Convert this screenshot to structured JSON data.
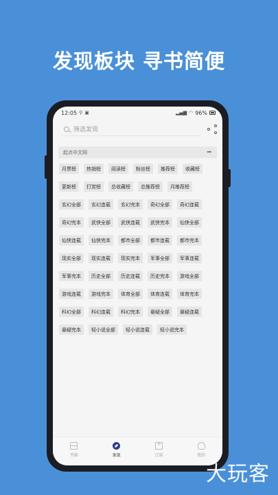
{
  "headline": "发现板块  寻书简便",
  "statusbar": {
    "time": "12:05",
    "battery": "96%"
  },
  "search": {
    "placeholder": "筛选发现"
  },
  "section": {
    "title": "起点中文网",
    "collapse_symbol": "−"
  },
  "chips": [
    "月票榜",
    "热销榜",
    "阅读榜",
    "粉丝榜",
    "推荐榜",
    "收藏榜",
    "更新榜",
    "打赏榜",
    "总收藏榜",
    "总推荐榜",
    "月推荐榜",
    "玄幻全部",
    "玄幻连载",
    "玄幻完本",
    "奇幻全部",
    "奇幻连载",
    "奇幻完本",
    "武侠全部",
    "武侠连载",
    "武侠完本",
    "仙侠全部",
    "仙侠连载",
    "仙侠完本",
    "都市全部",
    "都市连载",
    "都市完本",
    "现实全部",
    "现实连载",
    "现实完本",
    "军事全部",
    "军事连载",
    "军事完本",
    "历史全部",
    "历史连载",
    "历史完本",
    "游戏全部",
    "游戏连载",
    "游戏完本",
    "体育全部",
    "体育连载",
    "体育完本",
    "科幻全部",
    "科幻连载",
    "科幻完本",
    "悬疑全部",
    "悬疑连载",
    "悬疑完本",
    "轻小说全部",
    "轻小说连载",
    "轻小说完本"
  ],
  "nav": [
    {
      "label": "书架",
      "icon": "bookshelf-icon"
    },
    {
      "label": "发现",
      "icon": "discover-icon"
    },
    {
      "label": "订阅",
      "icon": "subscribe-icon"
    },
    {
      "label": "我的",
      "icon": "profile-icon"
    }
  ],
  "nav_active": 1,
  "watermark": "大玩客",
  "colors": {
    "background": "#4a90d9",
    "active_nav": "#2c3e8c"
  }
}
